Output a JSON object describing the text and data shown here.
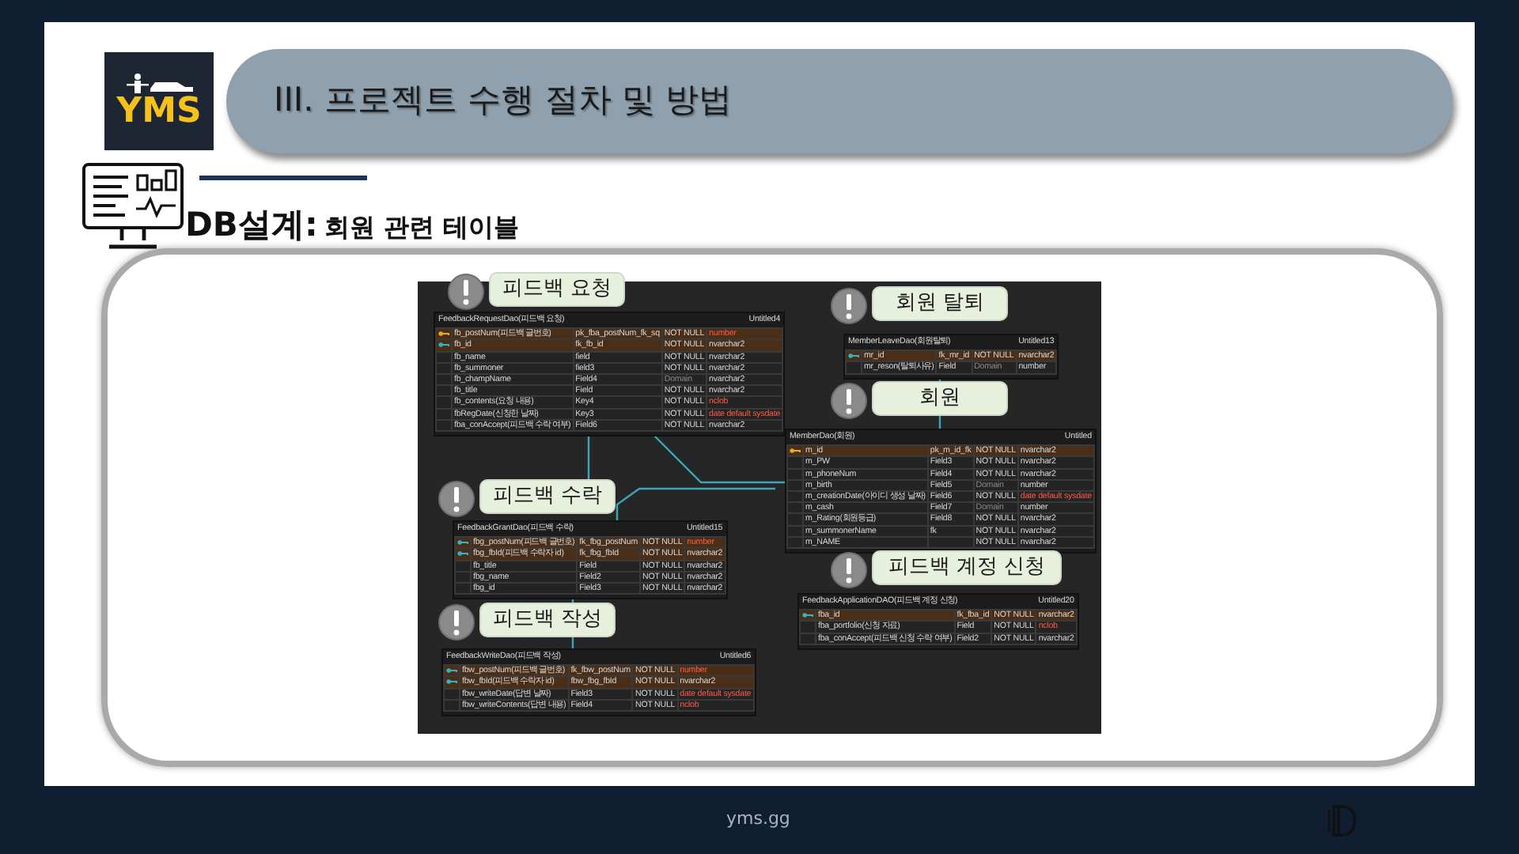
{
  "slide": {
    "logo_text": "YMS",
    "title": "III. 프로젝트 수행 절차 및 방법",
    "heading_lead": "DB설계:",
    "heading_text": "회원 관련 테이블"
  },
  "erd": {
    "callouts": [
      {
        "label": "피드백 요청"
      },
      {
        "label": "회원 탈퇴"
      },
      {
        "label": "회원"
      },
      {
        "label": "피드백 수락"
      },
      {
        "label": "피드백 작성"
      },
      {
        "label": "피드백 계정 신청"
      }
    ],
    "tables": [
      {
        "title": "FeedbackRequestDao(피드백 요청)",
        "tag": "Untitled4",
        "rows": [
          {
            "kind": "primary",
            "name": "fb_postNum(피드백 글번호)",
            "field": "pk_fba_postNum_fk_sq",
            "null_rule": "NOT NULL",
            "null_disabled": false,
            "type": "number",
            "type_alert": true
          },
          {
            "kind": "foreign",
            "name": "fb_id",
            "field": "fk_fb_id",
            "null_rule": "NOT NULL",
            "null_disabled": false,
            "type": "nvarchar2",
            "type_alert": false
          },
          {
            "kind": "plain",
            "name": "fb_name",
            "field": "field",
            "null_rule": "NOT NULL",
            "null_disabled": false,
            "type": "nvarchar2",
            "type_alert": false
          },
          {
            "kind": "plain",
            "name": "fb_summoner",
            "field": "field3",
            "null_rule": "NOT NULL",
            "null_disabled": false,
            "type": "nvarchar2",
            "type_alert": false
          },
          {
            "kind": "plain",
            "name": "fb_champName",
            "field": "Field4",
            "null_rule": "Domain",
            "null_disabled": true,
            "type": "nvarchar2",
            "type_alert": false
          },
          {
            "kind": "plain",
            "name": "fb_title",
            "field": "Field",
            "null_rule": "NOT NULL",
            "null_disabled": false,
            "type": "nvarchar2",
            "type_alert": false
          },
          {
            "kind": "plain",
            "name": "fb_contents(요청 내용)",
            "field": "Key4",
            "null_rule": "NOT NULL",
            "null_disabled": false,
            "type": "nclob",
            "type_alert": true
          },
          {
            "kind": "plain",
            "name": "fbRegDate(신청한 날짜)",
            "field": "Key3",
            "null_rule": "NOT NULL",
            "null_disabled": false,
            "type": "date default sysdate",
            "type_alert": true
          },
          {
            "kind": "plain",
            "name": "fba_conAccept(피드백 수락 여부)",
            "field": "Field6",
            "null_rule": "NOT NULL",
            "null_disabled": false,
            "type": "nvarchar2",
            "type_alert": false
          }
        ]
      },
      {
        "title": "MemberLeaveDao(회원탈퇴)",
        "tag": "Untitled13",
        "rows": [
          {
            "kind": "foreign",
            "name": "mr_id",
            "field": "fk_mr_id",
            "null_rule": "NOT NULL",
            "null_disabled": false,
            "type": "nvarchar2",
            "type_alert": false
          },
          {
            "kind": "plain",
            "name": "mr_reson(탈퇴사유)",
            "field": "Field",
            "null_rule": "Domain",
            "null_disabled": true,
            "type": "number",
            "type_alert": false
          }
        ]
      },
      {
        "title": "MemberDao(회원)",
        "tag": "Untitled",
        "rows": [
          {
            "kind": "primary",
            "name": "m_id",
            "field": "pk_m_id_fk",
            "null_rule": "NOT NULL",
            "null_disabled": false,
            "type": "nvarchar2",
            "type_alert": false
          },
          {
            "kind": "plain",
            "name": "m_PW",
            "field": "Field3",
            "null_rule": "NOT NULL",
            "null_disabled": false,
            "type": "nvarchar2",
            "type_alert": false
          },
          {
            "kind": "plain",
            "name": "m_phoneNum",
            "field": "Field4",
            "null_rule": "NOT NULL",
            "null_disabled": false,
            "type": "nvarchar2",
            "type_alert": false
          },
          {
            "kind": "plain",
            "name": "m_birth",
            "field": "Field5",
            "null_rule": "Domain",
            "null_disabled": true,
            "type": "number",
            "type_alert": false
          },
          {
            "kind": "plain",
            "name": "m_creationDate(아이디 생성 날짜)",
            "field": "Field6",
            "null_rule": "NOT NULL",
            "null_disabled": false,
            "type": "date default sysdate",
            "type_alert": true
          },
          {
            "kind": "plain",
            "name": "m_cash",
            "field": "Field7",
            "null_rule": "Domain",
            "null_disabled": true,
            "type": "number",
            "type_alert": false
          },
          {
            "kind": "plain",
            "name": "m_Rating(회원등급)",
            "field": "Field8",
            "null_rule": "NOT NULL",
            "null_disabled": false,
            "type": "nvarchar2",
            "type_alert": false
          },
          {
            "kind": "plain",
            "name": "m_summonerName",
            "field": "fk",
            "null_rule": "NOT NULL",
            "null_disabled": false,
            "type": "nvarchar2",
            "type_alert": false
          },
          {
            "kind": "plain",
            "name": "m_NAME",
            "null_rule": "NOT NULL",
            "null_disabled": false,
            "type": "nvarchar2",
            "type_alert": false
          }
        ]
      },
      {
        "title": "FeedbackGrantDao(피드백 수락)",
        "tag": "Untitled15",
        "rows": [
          {
            "kind": "foreign",
            "name": "fbg_postNum(피드백 글번호)",
            "field": "fk_fbg_postNum",
            "null_rule": "NOT NULL",
            "null_disabled": false,
            "type": "number",
            "type_alert": true
          },
          {
            "kind": "foreign",
            "name": "fbg_fbId(피드백 수락자 id)",
            "field": "fk_fbg_fbId",
            "null_rule": "NOT NULL",
            "null_disabled": false,
            "type": "nvarchar2",
            "type_alert": false
          },
          {
            "kind": "plain",
            "name": "fb_title",
            "field": "Field",
            "null_rule": "NOT NULL",
            "null_disabled": false,
            "type": "nvarchar2",
            "type_alert": false
          },
          {
            "kind": "plain",
            "name": "fbg_name",
            "field": "Field2",
            "null_rule": "NOT NULL",
            "null_disabled": false,
            "type": "nvarchar2",
            "type_alert": false
          },
          {
            "kind": "plain",
            "name": "fbg_id",
            "field": "Field3",
            "null_rule": "NOT NULL",
            "null_disabled": false,
            "type": "nvarchar2",
            "type_alert": false
          }
        ]
      },
      {
        "title": "FeedbackWriteDao(피드백 작성)",
        "tag": "Untitled6",
        "rows": [
          {
            "kind": "foreign",
            "name": "fbw_postNum(피드백 글번호)",
            "field": "fk_fbw_postNum",
            "null_rule": "NOT NULL",
            "null_disabled": false,
            "type": "number",
            "type_alert": true
          },
          {
            "kind": "foreign",
            "name": "fbw_fbId(피드백 수락자 id)",
            "field": "fbw_fbg_fbId",
            "null_rule": "NOT NULL",
            "null_disabled": false,
            "type": "nvarchar2",
            "type_alert": false
          },
          {
            "kind": "plain",
            "name": "fbw_writeDate(답변 날짜)",
            "field": "Field3",
            "null_rule": "NOT NULL",
            "null_disabled": false,
            "type": "date default sysdate",
            "type_alert": true
          },
          {
            "kind": "plain",
            "name": "fbw_writeContents(답변 내용)",
            "field": "Field4",
            "null_rule": "NOT NULL",
            "null_disabled": false,
            "type": "nclob",
            "type_alert": true
          }
        ]
      },
      {
        "title": "FeedbackApplicationDAO(피드백 계정 신청)",
        "tag": "Untitled20",
        "rows": [
          {
            "kind": "foreign",
            "name": "fba_id",
            "field": "fk_fba_id",
            "null_rule": "NOT NULL",
            "null_disabled": false,
            "type": "nvarchar2",
            "type_alert": false
          },
          {
            "kind": "plain",
            "name": "fba_portfolio(신청 자료)",
            "field": "Field",
            "null_rule": "NOT NULL",
            "null_disabled": false,
            "type": "nclob",
            "type_alert": true
          },
          {
            "kind": "plain",
            "name": "fba_conAccept(피드백 신청 수락 여부)",
            "field": "Field2",
            "null_rule": "NOT NULL",
            "null_disabled": false,
            "type": "nvarchar2",
            "type_alert": false
          }
        ]
      }
    ]
  },
  "footer": {
    "site": "yms.gg"
  }
}
